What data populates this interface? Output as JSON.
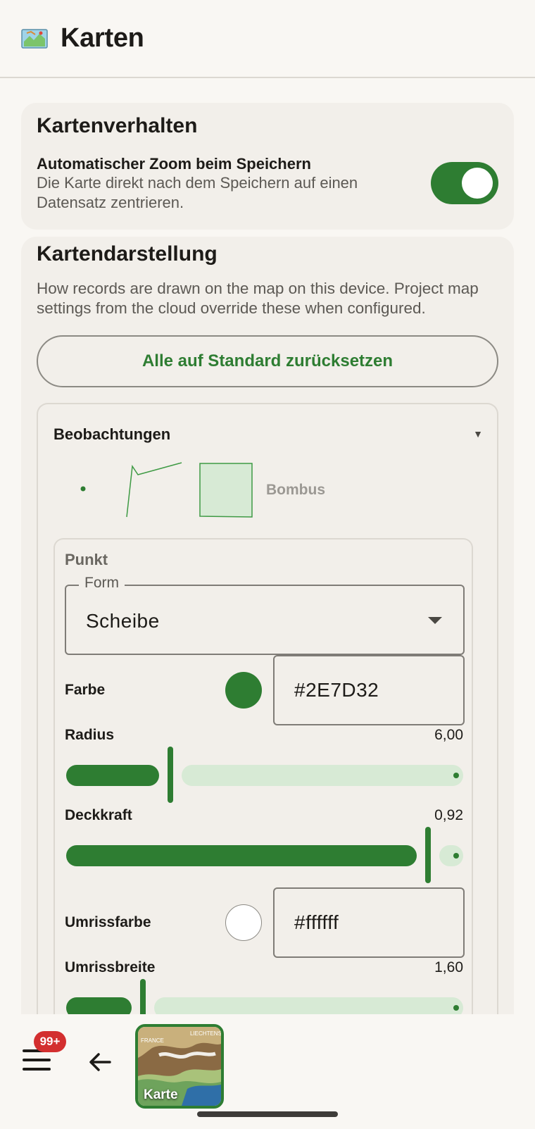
{
  "header": {
    "title": "Karten",
    "icon": "map-icon"
  },
  "behavior": {
    "title": "Kartenverhalten",
    "auto_zoom_label": "Automatischer Zoom beim Speichern",
    "auto_zoom_desc": "Die Karte direkt nach dem Speichern auf einen Datensatz zentrieren.",
    "auto_zoom_on": true
  },
  "display": {
    "title": "Kartendarstellung",
    "desc": "How records are drawn on the map on this device. Project map settings from the cloud override these when configured.",
    "reset_label": "Alle auf Standard zurücksetzen",
    "layer": {
      "title": "Beobachtungen",
      "species": "Bombus",
      "point": {
        "section_label": "Punkt",
        "form_label": "Form",
        "form_value": "Scheibe",
        "color_label": "Farbe",
        "color_value": "#2E7D32",
        "radius_label": "Radius",
        "radius_value": "6,00",
        "radius_fraction": 0.26,
        "opacity_label": "Deckkraft",
        "opacity_value": "0,92",
        "opacity_fraction": 0.92,
        "outline_color_label": "Umrissfarbe",
        "outline_color_value": "#ffffff",
        "outline_width_label": "Umrissbreite",
        "outline_width_value": "1,60",
        "outline_width_fraction": 0.19
      }
    }
  },
  "bottom_nav": {
    "badge": "99+",
    "map_tile_label": "Karte",
    "map_tile_text_1": "FRANCE",
    "map_tile_text_2": "LIECHTENS"
  },
  "colors": {
    "accent": "#2e7d32",
    "badge": "#d32f2f",
    "track_inactive": "#d7ead5"
  }
}
